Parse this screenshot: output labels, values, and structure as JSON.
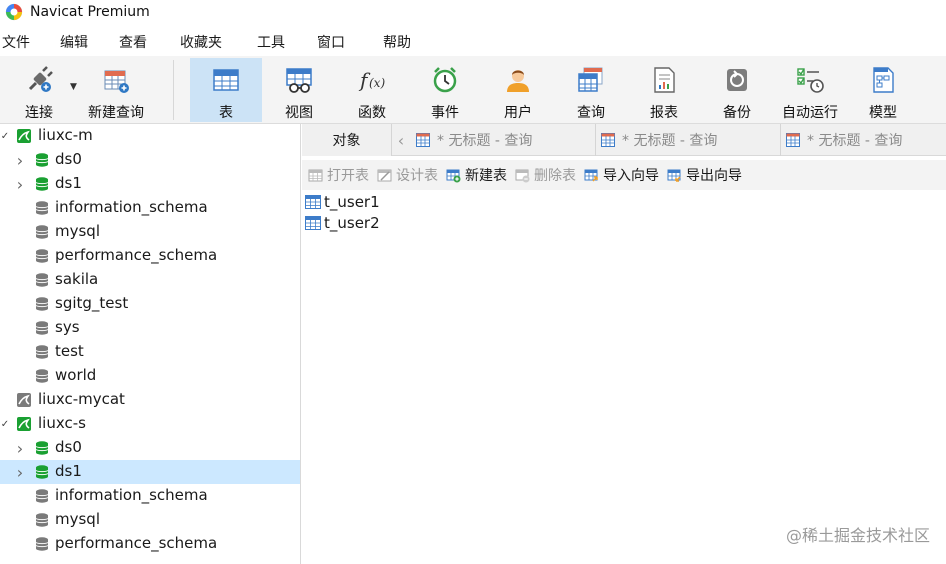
{
  "window": {
    "title": "Navicat Premium"
  },
  "menu": [
    "文件",
    "编辑",
    "查看",
    "收藏夹",
    "工具",
    "窗口",
    "帮助"
  ],
  "toolbar": {
    "connect": "连接",
    "new_query": "新建查询",
    "table": "表",
    "view": "视图",
    "function": "函数",
    "event": "事件",
    "user": "用户",
    "query": "查询",
    "report": "报表",
    "backup": "备份",
    "automation": "自动运行",
    "model": "模型",
    "active": "table"
  },
  "tree": [
    {
      "label": "liuxc-m",
      "type": "connection",
      "expanded": true,
      "level": 0
    },
    {
      "label": "ds0",
      "type": "database-open",
      "collapsible": true,
      "level": 1
    },
    {
      "label": "ds1",
      "type": "database-open",
      "collapsible": true,
      "level": 1
    },
    {
      "label": "information_schema",
      "type": "database",
      "level": 1
    },
    {
      "label": "mysql",
      "type": "database",
      "level": 1
    },
    {
      "label": "performance_schema",
      "type": "database",
      "level": 1
    },
    {
      "label": "sakila",
      "type": "database",
      "level": 1
    },
    {
      "label": "sgitg_test",
      "type": "database",
      "level": 1
    },
    {
      "label": "sys",
      "type": "database",
      "level": 1
    },
    {
      "label": "test",
      "type": "database",
      "level": 1
    },
    {
      "label": "world",
      "type": "database",
      "level": 1
    },
    {
      "label": "liuxc-mycat",
      "type": "connection-closed",
      "level": 0
    },
    {
      "label": "liuxc-s",
      "type": "connection",
      "expanded": true,
      "level": 0
    },
    {
      "label": "ds0",
      "type": "database-open",
      "collapsible": true,
      "level": 1
    },
    {
      "label": "ds1",
      "type": "database-open",
      "collapsible": true,
      "level": 1,
      "selected": true
    },
    {
      "label": "information_schema",
      "type": "database",
      "level": 1
    },
    {
      "label": "mysql",
      "type": "database",
      "level": 1
    },
    {
      "label": "performance_schema",
      "type": "database",
      "level": 1
    }
  ],
  "tabs": {
    "objects": "对象",
    "query_tabs": [
      "* 无标题 - 查询",
      "* 无标题 - 查询",
      "* 无标题 - 查询"
    ]
  },
  "object_toolbar": {
    "open_table": "打开表",
    "design_table": "设计表",
    "new_table": "新建表",
    "delete_table": "删除表",
    "import_wizard": "导入向导",
    "export_wizard": "导出向导"
  },
  "objects": [
    "t_user1",
    "t_user2"
  ],
  "watermark": "@稀土掘金技术社区",
  "colors": {
    "selection": "#cce8ff",
    "toolbar_active": "#cce3f6",
    "db_open": "#1aa032",
    "db_closed": "#7a7a7a"
  }
}
